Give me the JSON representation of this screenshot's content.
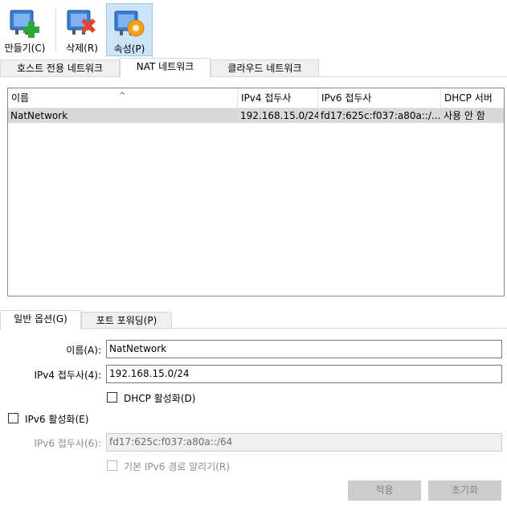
{
  "toolbar": {
    "create_label": "만들기(C)",
    "delete_label": "삭제(R)",
    "properties_label": "속성(P)"
  },
  "main_tabs": {
    "host_only": "호스트 전용 네트워크",
    "nat": "NAT 네트워크",
    "cloud": "클라우드 네트워크"
  },
  "list": {
    "columns": {
      "name": "이름",
      "ipv4": "IPv4 접두사",
      "ipv6": "IPv6 접두사",
      "dhcp": "DHCP 서버"
    },
    "rows": [
      {
        "name": "NatNetwork",
        "ipv4": "192.168.15.0/24",
        "ipv6": "fd17:625c:f037:a80a::/...",
        "dhcp": "사용 안 함"
      }
    ]
  },
  "detail_tabs": {
    "general": "일반 옵션(G)",
    "port_forwarding": "포트 포워딩(P)"
  },
  "form": {
    "name_label": "이름(A):",
    "name_value": "NatNetwork",
    "ipv4_label": "IPv4 접두사(4):",
    "ipv4_value": "192.168.15.0/24",
    "dhcp_label": "DHCP 활성화(D)",
    "ipv6_enable_label": "IPv6 활성화(E)",
    "ipv6_label": "IPv6 접두사(6):",
    "ipv6_value": "fd17:625c:f037:a80a::/64",
    "default_route_label": "기본 IPv6 경로 알리기(R)"
  },
  "buttons": {
    "apply": "적용",
    "reset": "초기화"
  },
  "colors": {
    "selected_tool": "#cce4f7",
    "selected_row": "#d9d9d9"
  }
}
